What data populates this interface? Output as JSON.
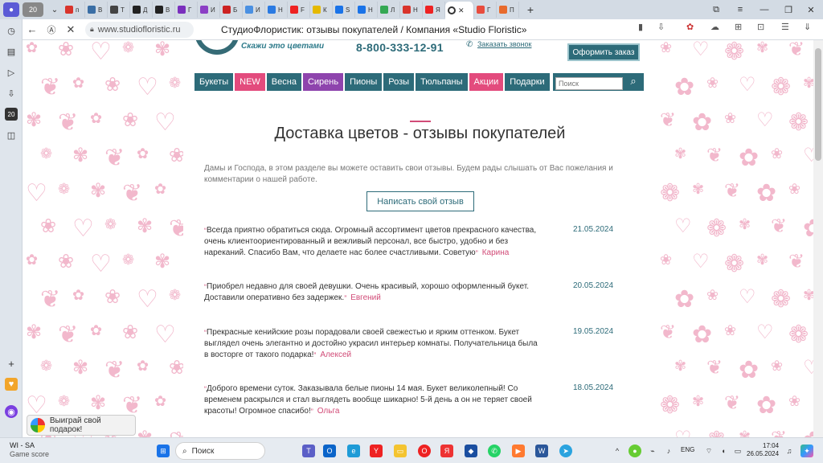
{
  "browser": {
    "tab_count": "20",
    "tabs": [
      {
        "label": "п",
        "color": "#d9342b"
      },
      {
        "label": "В",
        "color": "#3a6ea5"
      },
      {
        "label": "Т",
        "color": "#444444"
      },
      {
        "label": "Д",
        "color": "#222222"
      },
      {
        "label": "В",
        "color": "#222222"
      },
      {
        "label": "Г",
        "color": "#7a2fbd"
      },
      {
        "label": "И",
        "color": "#8b3fc5"
      },
      {
        "label": "Б",
        "color": "#c22"
      },
      {
        "label": "И",
        "color": "#4a90e2"
      },
      {
        "label": "Н",
        "color": "#2a7ae2"
      },
      {
        "label": "F",
        "color": "#e22"
      },
      {
        "label": "К",
        "color": "#e5b900"
      },
      {
        "label": "S",
        "color": "#1a73e8"
      },
      {
        "label": "Н",
        "color": "#1a73e8"
      },
      {
        "label": "Л",
        "color": "#34a853"
      },
      {
        "label": "Н",
        "color": "#d9342b"
      },
      {
        "label": "Я",
        "color": "#e22"
      }
    ],
    "tabs_after_active": [
      {
        "label": "Г",
        "color": "#e84c3d"
      },
      {
        "label": "П",
        "color": "#e86b2d"
      }
    ],
    "url": "www.studiofloristic.ru",
    "title": "СтудиоФлористик: отзывы покупателей / Компания «Studio Floristic»"
  },
  "site": {
    "slogan": "Скажи это цветами",
    "phone": "8-800-333-12-91",
    "callback": "Заказать звонок",
    "order_button": "Оформить заказ",
    "menu": [
      {
        "label": "Букеты",
        "color": "#2d6b79"
      },
      {
        "label": "NEW",
        "color": "#e34b7d"
      },
      {
        "label": "Весна",
        "color": "#2d6b79"
      },
      {
        "label": "Сирень",
        "color": "#8e44ad"
      },
      {
        "label": "Пионы",
        "color": "#2d6b79"
      },
      {
        "label": "Розы",
        "color": "#2d6b79"
      },
      {
        "label": "Тюльпаны",
        "color": "#2d6b79"
      },
      {
        "label": "Акции",
        "color": "#e34b7d"
      },
      {
        "label": "Подарки",
        "color": "#2d6b79"
      }
    ],
    "search_placeholder": "Поиск",
    "heading": "Доставка цветов - отзывы покупателей",
    "intro": "Дамы и Господа, в этом разделе вы можете оставить свои отзывы. Будем рады слышать от Вас пожелания и комментарии о нашей работе.",
    "write_review": "Написать свой отзыв",
    "reviews": [
      {
        "text": "Всегда приятно обратиться сюда. Огромный ассортимент цветов прекрасного качества, очень клиентоориентированный и вежливый персонал, все быстро, удобно и без нареканий. Спасибо Вам, что делаете нас более счастливыми. Советую",
        "author": "Карина",
        "date": "21.05.2024"
      },
      {
        "text": "Приобрел недавно для своей девушки. Очень красивый, хорошо оформленный букет. Доставили оперативно без задержек.",
        "author": "Евгений",
        "date": "20.05.2024"
      },
      {
        "text": "Прекрасные кенийские розы порадовали своей свежестью и ярким оттенком. Букет выглядел очень элегантно и достойно украсил интерьер комнаты. Получательница была в восторге от такого подарка!",
        "author": "Алексей",
        "date": "19.05.2024"
      },
      {
        "text": "Доброго времени суток. Заказывала белые пионы 14 мая. Букет великолепный! Со временем раскрылся и стал выглядеть вообще шикарно! 5-й день а он не теряет своей красоты! Огромное спасибо!",
        "author": "Ольга",
        "date": "18.05.2024"
      }
    ],
    "open_quote": "“",
    "close_quote": "”"
  },
  "promo": "Выиграй свой подарок!",
  "taskbar": {
    "weather_title": "WI - SA",
    "weather_sub": "Game score",
    "search": "Поиск",
    "lang": "ENG",
    "time": "17:04",
    "date": "26.05.2024"
  }
}
